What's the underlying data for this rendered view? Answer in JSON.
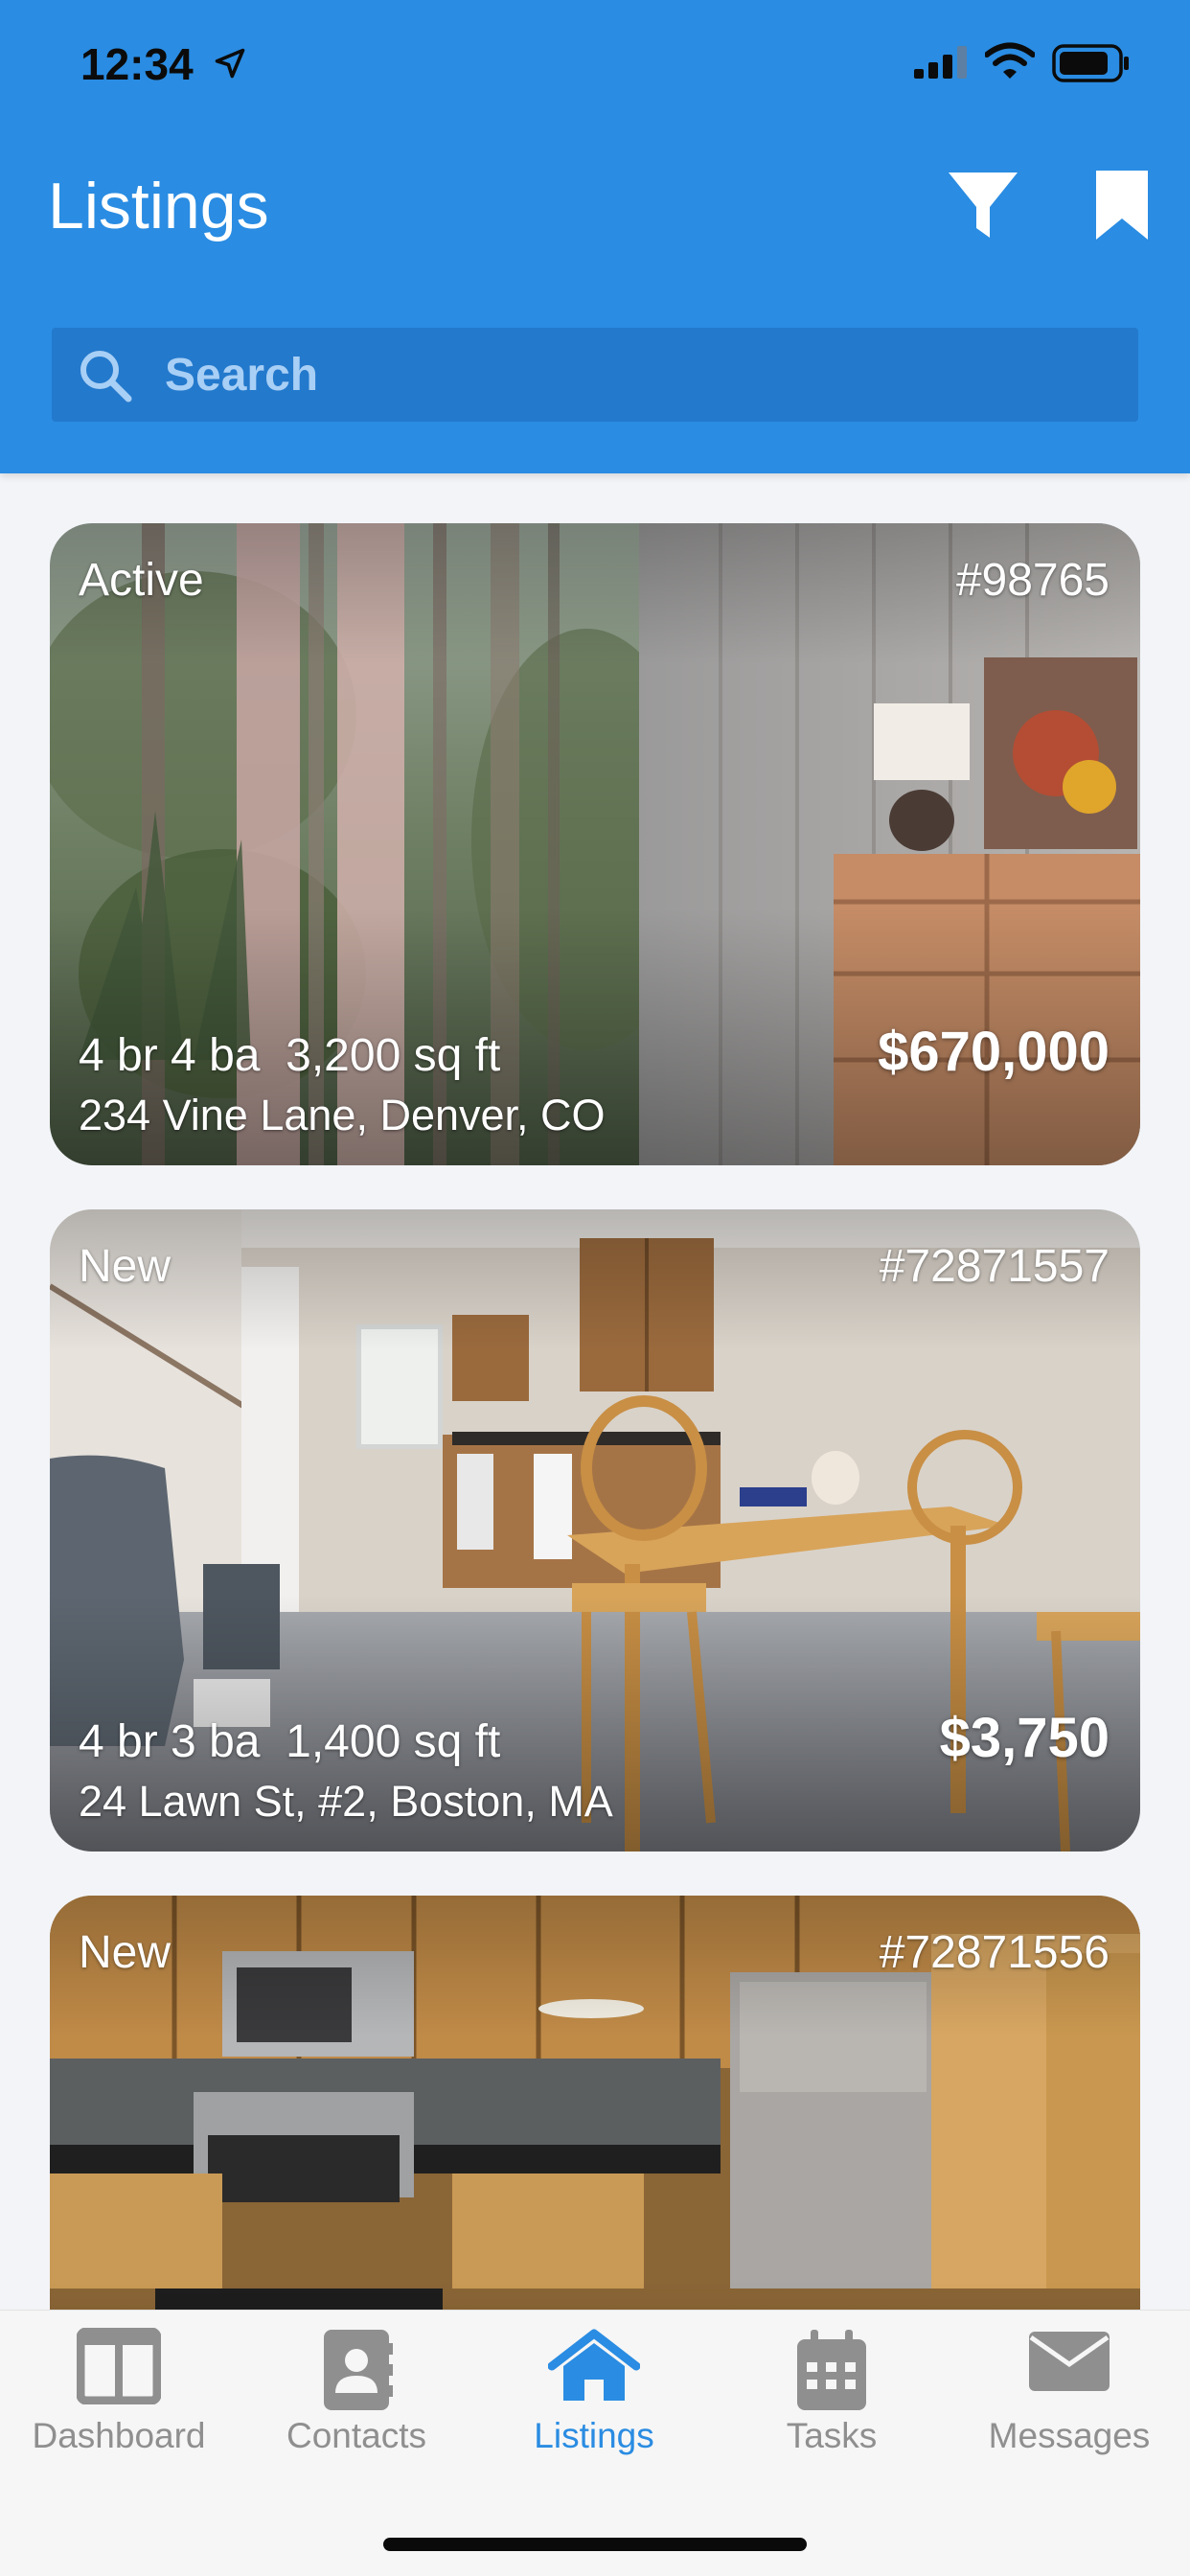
{
  "status_bar": {
    "time": "12:34"
  },
  "header": {
    "title": "Listings",
    "search": {
      "placeholder": "Search"
    },
    "icons": [
      "filter-icon",
      "bookmark-icon"
    ]
  },
  "listings": [
    {
      "status": "Active",
      "id": "#98765",
      "details": "4 br 4 ba  3,200 sq ft",
      "address": "234 Vine Lane, Denver, CO",
      "price": "$670,000"
    },
    {
      "status": "New",
      "id": "#72871557",
      "details": "4 br 3 ba  1,400 sq ft",
      "address": "24 Lawn St, #2, Boston, MA",
      "price": "$3,750"
    },
    {
      "status": "New",
      "id": "#72871556"
    }
  ],
  "tab_bar": {
    "active": "Listings",
    "tabs": [
      {
        "label": "Dashboard",
        "icon": "dashboard-icon"
      },
      {
        "label": "Contacts",
        "icon": "contacts-icon"
      },
      {
        "label": "Listings",
        "icon": "home-icon"
      },
      {
        "label": "Tasks",
        "icon": "calendar-icon"
      },
      {
        "label": "Messages",
        "icon": "envelope-icon"
      }
    ]
  },
  "colors": {
    "header_blue": "#2a8ce2",
    "search_bg": "#2379cc",
    "tab_active": "#2a8ce2",
    "tab_inactive": "#8f8f8f"
  }
}
